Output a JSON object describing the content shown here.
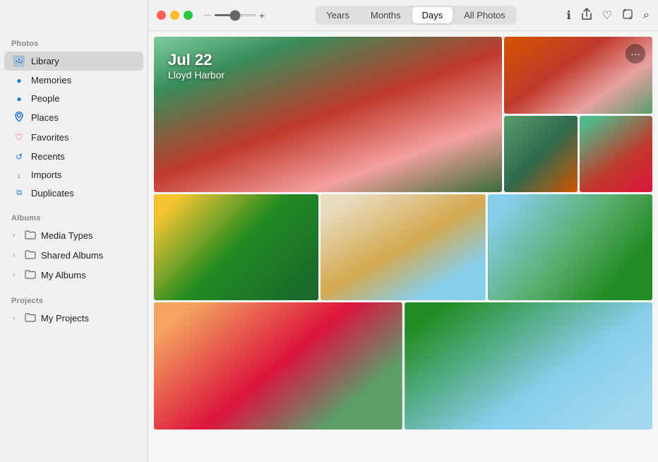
{
  "window": {
    "title": "Photos"
  },
  "sidebar": {
    "sections": [
      {
        "label": "Photos",
        "items": [
          {
            "id": "library",
            "label": "Library",
            "icon": "🖼",
            "iconClass": "blue",
            "active": true
          },
          {
            "id": "memories",
            "label": "Memories",
            "icon": "⊙",
            "iconClass": "blue"
          },
          {
            "id": "people",
            "label": "People",
            "icon": "⊙",
            "iconClass": "blue"
          },
          {
            "id": "places",
            "label": "Places",
            "icon": "⊕",
            "iconClass": "blue"
          },
          {
            "id": "favorites",
            "label": "Favorites",
            "icon": "♡",
            "iconClass": "pink"
          },
          {
            "id": "recents",
            "label": "Recents",
            "icon": "⊙",
            "iconClass": "blue"
          },
          {
            "id": "imports",
            "label": "Imports",
            "icon": "⊕",
            "iconClass": "blue"
          },
          {
            "id": "duplicates",
            "label": "Duplicates",
            "icon": "⊞",
            "iconClass": "blue"
          }
        ]
      },
      {
        "label": "Albums",
        "items": [
          {
            "id": "media-types",
            "label": "Media Types",
            "icon": "🗂",
            "expandable": true
          },
          {
            "id": "shared-albums",
            "label": "Shared Albums",
            "icon": "🗂",
            "expandable": true
          },
          {
            "id": "my-albums",
            "label": "My Albums",
            "icon": "🗂",
            "expandable": true
          }
        ]
      },
      {
        "label": "Projects",
        "items": [
          {
            "id": "my-projects",
            "label": "My Projects",
            "icon": "🗂",
            "expandable": true
          }
        ]
      }
    ]
  },
  "toolbar": {
    "tabs": [
      {
        "id": "years",
        "label": "Years",
        "active": false
      },
      {
        "id": "months",
        "label": "Months",
        "active": false
      },
      {
        "id": "days",
        "label": "Days",
        "active": true
      },
      {
        "id": "all-photos",
        "label": "All Photos",
        "active": false
      }
    ],
    "icons": {
      "info": "ℹ",
      "share": "⬆",
      "heart": "♡",
      "crop": "⬜",
      "search": "⌕"
    }
  },
  "day_header": {
    "date": "Jul 22",
    "location": "Lloyd Harbor"
  },
  "zoom": {
    "plus_label": "+"
  }
}
